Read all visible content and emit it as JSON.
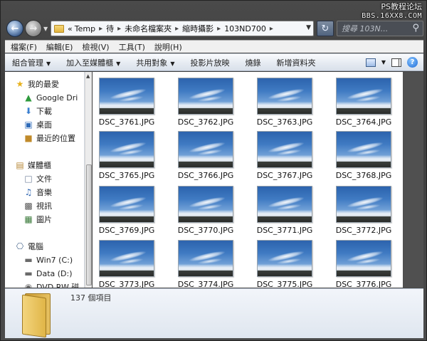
{
  "watermark": {
    "line1": "PS教程论坛",
    "line2": "BBS.16XX8.COM"
  },
  "address": {
    "prefix": "«",
    "crumbs": [
      "Temp",
      "待",
      "未命名檔案夾",
      "縮時攝影",
      "103ND700"
    ]
  },
  "search": {
    "placeholder": "搜尋 103N..."
  },
  "menu": [
    "檔案(F)",
    "編輯(E)",
    "檢視(V)",
    "工具(T)",
    "說明(H)"
  ],
  "commands": [
    {
      "label": "組合管理",
      "dropdown": true
    },
    {
      "label": "加入至媒體櫃",
      "dropdown": true
    },
    {
      "label": "共用對象",
      "dropdown": true
    },
    {
      "label": "投影片放映",
      "dropdown": false
    },
    {
      "label": "燒錄",
      "dropdown": false
    },
    {
      "label": "新增資料夾",
      "dropdown": false
    }
  ],
  "navpane": {
    "favorites": [
      "我的最愛",
      "Google Dri",
      "下載",
      "桌面",
      "最近的位置"
    ],
    "libraries": [
      "媒體櫃",
      "文件",
      "音樂",
      "視訊",
      "圖片"
    ],
    "computer": [
      "電腦",
      "Win7 (C:)",
      "Data (D:)",
      "DVD RW 磁"
    ]
  },
  "files": [
    "DSC_3761.JPG",
    "DSC_3762.JPG",
    "DSC_3763.JPG",
    "DSC_3764.JPG",
    "DSC_3765.JPG",
    "DSC_3766.JPG",
    "DSC_3767.JPG",
    "DSC_3768.JPG",
    "DSC_3769.JPG",
    "DSC_3770.JPG",
    "DSC_3771.JPG",
    "DSC_3772.JPG",
    "DSC_3773.JPG",
    "DSC_3774.JPG",
    "DSC_3775.JPG",
    "DSC_3776.JPG"
  ],
  "details": {
    "count_text": "137 個項目"
  },
  "icons": {
    "back": "back-arrow-icon",
    "forward": "forward-arrow-icon",
    "refresh": "refresh-icon",
    "search": "search-icon",
    "views": "views-icon",
    "preview_pane": "preview-pane-icon",
    "help": "help-icon"
  },
  "colors": {
    "accent": "#2c63ad",
    "window_frame": "#3b3b3b"
  }
}
